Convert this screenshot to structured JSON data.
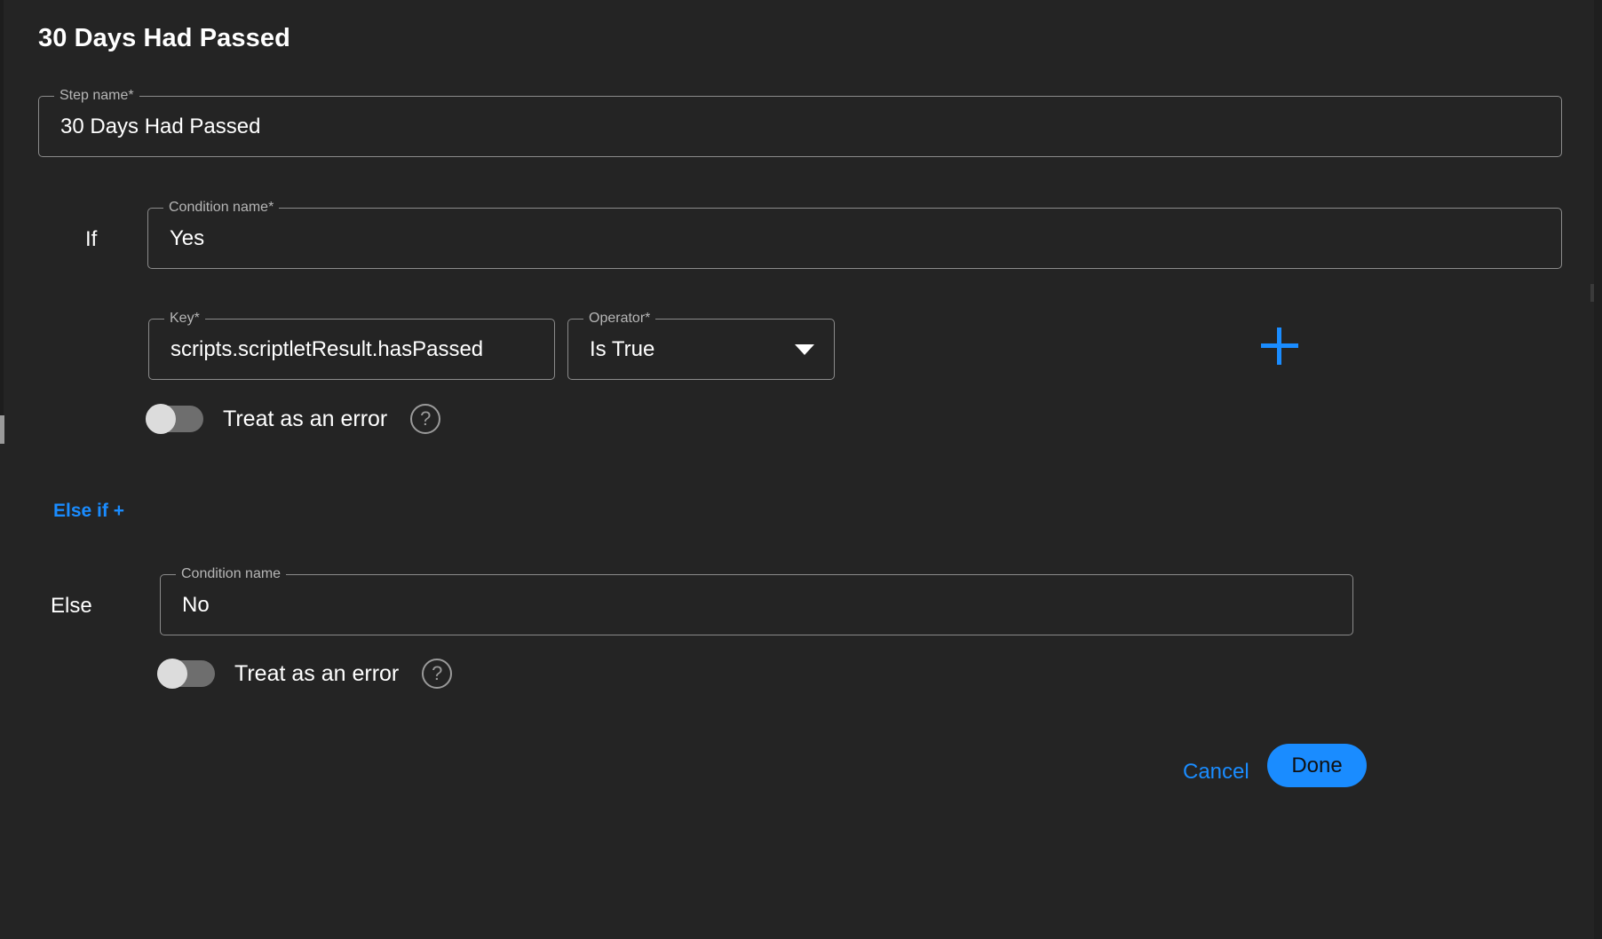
{
  "header": {
    "title": "30 Days Had Passed"
  },
  "step_name_field": {
    "label": "Step name",
    "required_mark": "*",
    "value": "30 Days Had Passed"
  },
  "if_branch": {
    "branch_label": "If",
    "condition_name_field": {
      "label": "Condition name",
      "required_mark": "*",
      "value": "Yes"
    },
    "key_field": {
      "label": "Key",
      "required_mark": "*",
      "value": "scripts.scriptletResult.hasPassed"
    },
    "operator_field": {
      "label": "Operator",
      "required_mark": "*",
      "value": "Is True",
      "caret_icon": "chevron-down-icon"
    },
    "add_condition_icon": "plus-icon",
    "treat_as_error": {
      "label": "Treat as an error",
      "state": "off",
      "help_icon": "help-circle-icon",
      "help_glyph": "?"
    }
  },
  "else_if_link": {
    "label": "Else if +"
  },
  "else_branch": {
    "branch_label": "Else",
    "condition_name_field": {
      "label": "Condition name",
      "required_mark": "",
      "value": "No"
    },
    "treat_as_error": {
      "label": "Treat as an error",
      "state": "off",
      "help_icon": "help-circle-icon",
      "help_glyph": "?"
    }
  },
  "footer": {
    "cancel_label": "Cancel",
    "done_label": "Done"
  },
  "colors": {
    "background": "#242424",
    "accent_blue": "#1a8cff",
    "field_border": "#8b8b8b",
    "label_gray": "#b6b6b6",
    "toggle_track": "#6e6e6e",
    "toggle_knob": "#dcdcdc"
  }
}
